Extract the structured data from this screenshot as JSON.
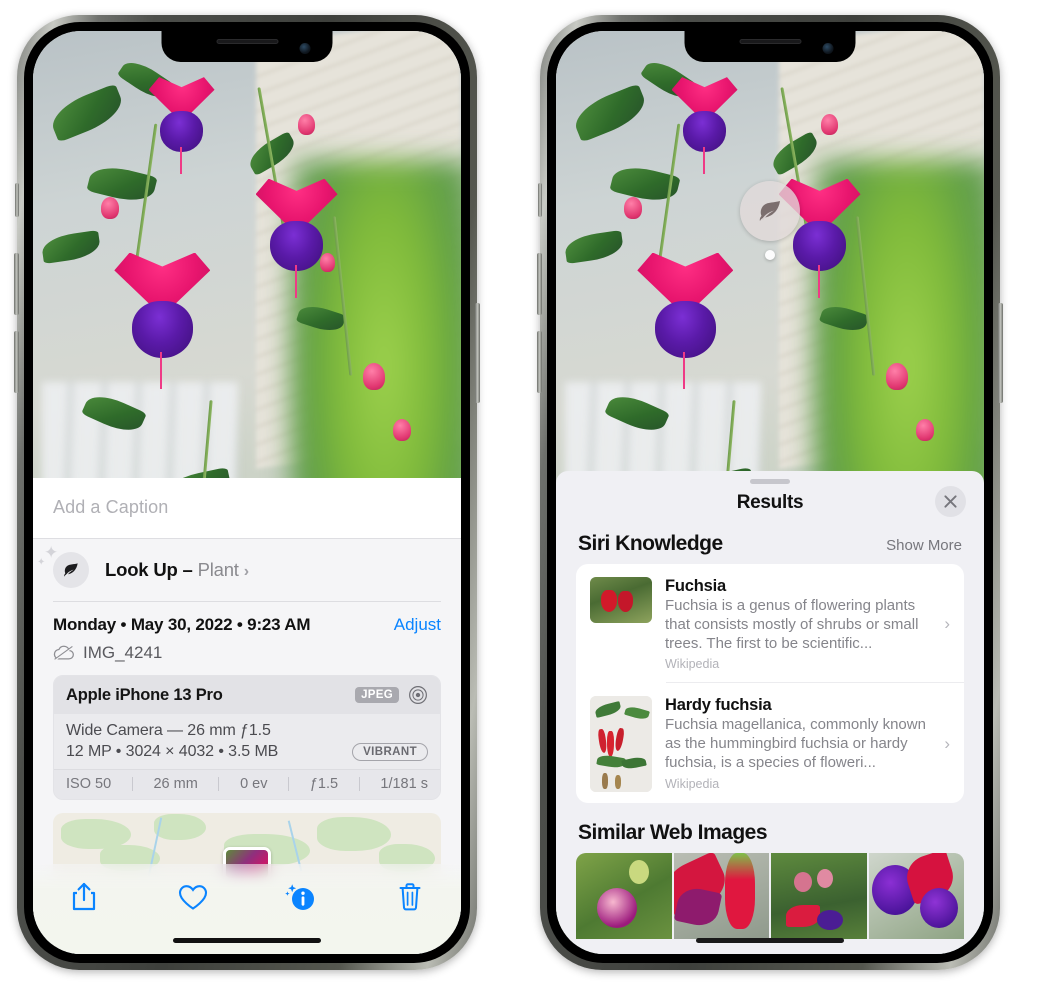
{
  "left_phone": {
    "caption": {
      "placeholder": "Add a Caption",
      "value": ""
    },
    "look_up": {
      "label": "Look Up –",
      "subject": "Plant",
      "chevron": "›",
      "icon": "leaf-icon"
    },
    "date": "Monday • May 30, 2022 • 9:23 AM",
    "adjust_label": "Adjust",
    "filename": "IMG_4241",
    "cloud_icon": "icloud-slash-icon",
    "metadata": {
      "device": "Apple iPhone 13 Pro",
      "format_badge": "JPEG",
      "aperture_icon": "aperture-icon",
      "lens": "Wide Camera — 26 mm ƒ1.5",
      "size_line": "12 MP • 3024 × 4032 • 3.5 MB",
      "style_badge": "VIBRANT",
      "exif": [
        "ISO 50",
        "26 mm",
        "0 ev",
        "ƒ1.5",
        "1/181 s"
      ]
    },
    "toolbar": [
      {
        "name": "share-button",
        "icon": "share-icon"
      },
      {
        "name": "favorite-button",
        "icon": "heart-icon"
      },
      {
        "name": "info-button",
        "icon": "info-sparkle-icon"
      },
      {
        "name": "delete-button",
        "icon": "trash-icon"
      }
    ]
  },
  "right_phone": {
    "detect_badge_icon": "leaf-icon",
    "sheet": {
      "title": "Results",
      "close_icon": "close-icon",
      "siri_knowledge": {
        "title": "Siri Knowledge",
        "show_more": "Show More",
        "items": [
          {
            "name": "Fuchsia",
            "description": "Fuchsia is a genus of flowering plants that consists mostly of shrubs or small trees. The first to be scientific...",
            "source": "Wikipedia",
            "chevron": "›"
          },
          {
            "name": "Hardy fuchsia",
            "description": "Fuchsia magellanica, commonly known as the hummingbird fuchsia or hardy fuchsia, is a species of floweri...",
            "source": "Wikipedia",
            "chevron": "›"
          }
        ]
      },
      "similar_web_images": {
        "title": "Similar Web Images",
        "count": 4
      }
    }
  },
  "colors": {
    "accent_blue": "#0a84ff",
    "sheet_bg": "#f0f0f4",
    "card_bg": "#ffffff",
    "secondary_text": "#85858b",
    "flower_pink": "#e8156e",
    "flower_purple": "#5a1aa8"
  }
}
